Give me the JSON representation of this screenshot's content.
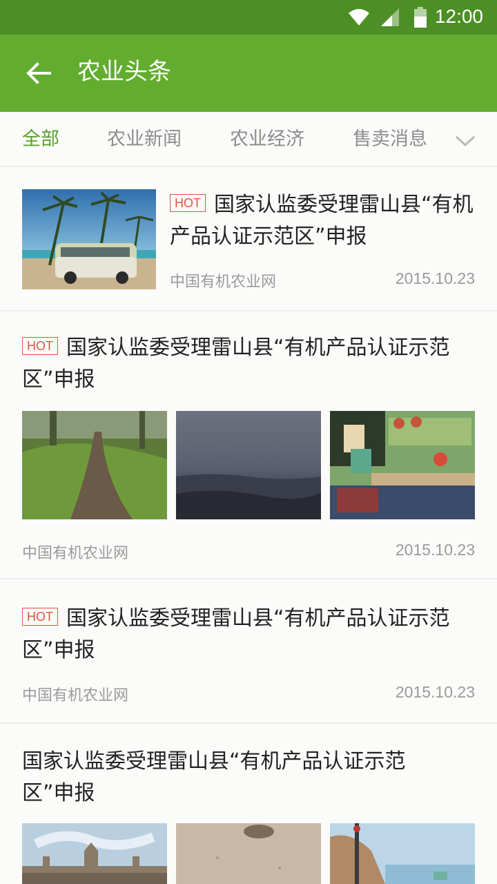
{
  "status_bar": {
    "time": "12:00",
    "icons": [
      "wifi-icon",
      "cell-signal-icon",
      "battery-icon"
    ]
  },
  "app_bar": {
    "title": "农业头条",
    "back_icon": "arrow-back-icon"
  },
  "tabs": [
    {
      "label": "全部",
      "active": true
    },
    {
      "label": "农业新闻",
      "active": false
    },
    {
      "label": "农业经济",
      "active": false
    },
    {
      "label": "售卖消息",
      "active": false
    }
  ],
  "tabs_more_icon": "chevron-down-icon",
  "colors": {
    "status_bar": "#4c8f24",
    "app_bar": "#62ad2f",
    "accent": "#5aa02b",
    "hot": "#e0533f"
  },
  "news": [
    {
      "badge": "HOT",
      "title": "国家认监委受理雷山县“有机产品认证示范区”申报",
      "source": "中国有机农业网",
      "date": "2015.10.23",
      "images": [
        "beach-van"
      ]
    },
    {
      "badge": "HOT",
      "title": "国家认监委受理雷山县“有机产品认证示范区”申报",
      "source": "中国有机农业网",
      "date": "2015.10.23",
      "images": [
        "forest-path",
        "foggy-sea",
        "cafe-table"
      ]
    },
    {
      "badge": "HOT",
      "title": "国家认监委受理雷山县“有机产品认证示范区”申报",
      "source": "中国有机农业网",
      "date": "2015.10.23",
      "images": []
    },
    {
      "badge": "",
      "title": "国家认监委受理雷山县“有机产品认证示范区”申报",
      "source": "",
      "date": "",
      "images": [
        "castle",
        "sand",
        "coast"
      ]
    }
  ]
}
